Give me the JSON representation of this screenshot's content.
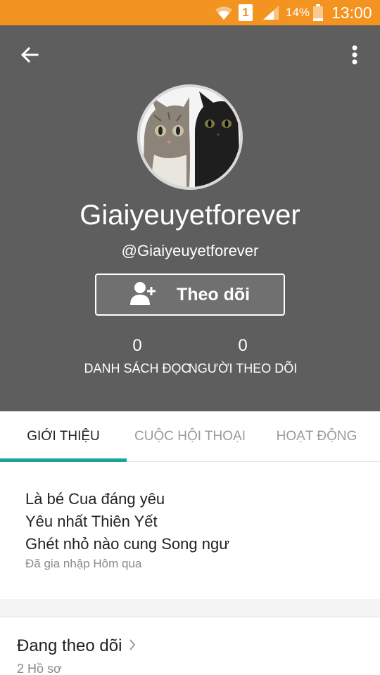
{
  "status_bar": {
    "sim_slot": "1",
    "battery_percent": "14%",
    "time": "13:00",
    "icons": [
      "wifi-icon",
      "sim-icon",
      "signal-icon",
      "battery-icon"
    ]
  },
  "header": {
    "back_icon": "back-arrow-icon",
    "more_icon": "more-vertical-icon",
    "display_name": "Giaiyeuyetforever",
    "username": "@Giaiyeuyetforever",
    "follow_button": {
      "icon": "add-user-icon",
      "label": "Theo dõi"
    },
    "stats": [
      {
        "value": "0",
        "label": "DANH SÁCH ĐỌC"
      },
      {
        "value": "0",
        "label": "NGƯỜI THEO DÕI"
      }
    ]
  },
  "tabs": [
    {
      "label": "GIỚI THIỆU",
      "active": true
    },
    {
      "label": "CUỘC HỘI THOẠI",
      "active": false
    },
    {
      "label": "HOẠT ĐỘNG",
      "active": false
    }
  ],
  "about": {
    "lines": [
      "Là bé Cua đáng yêu",
      "Yêu nhất Thiên Yết",
      "Ghét nhỏ nào cung Song ngư"
    ],
    "joined": "Đã gia nhập Hôm qua"
  },
  "following": {
    "title": "Đang theo dõi",
    "count": "2 Hồ sơ"
  },
  "colors": {
    "status_bar": "#f39420",
    "header_bg": "#5e5e5e",
    "tab_indicator": "#1aa39a"
  }
}
